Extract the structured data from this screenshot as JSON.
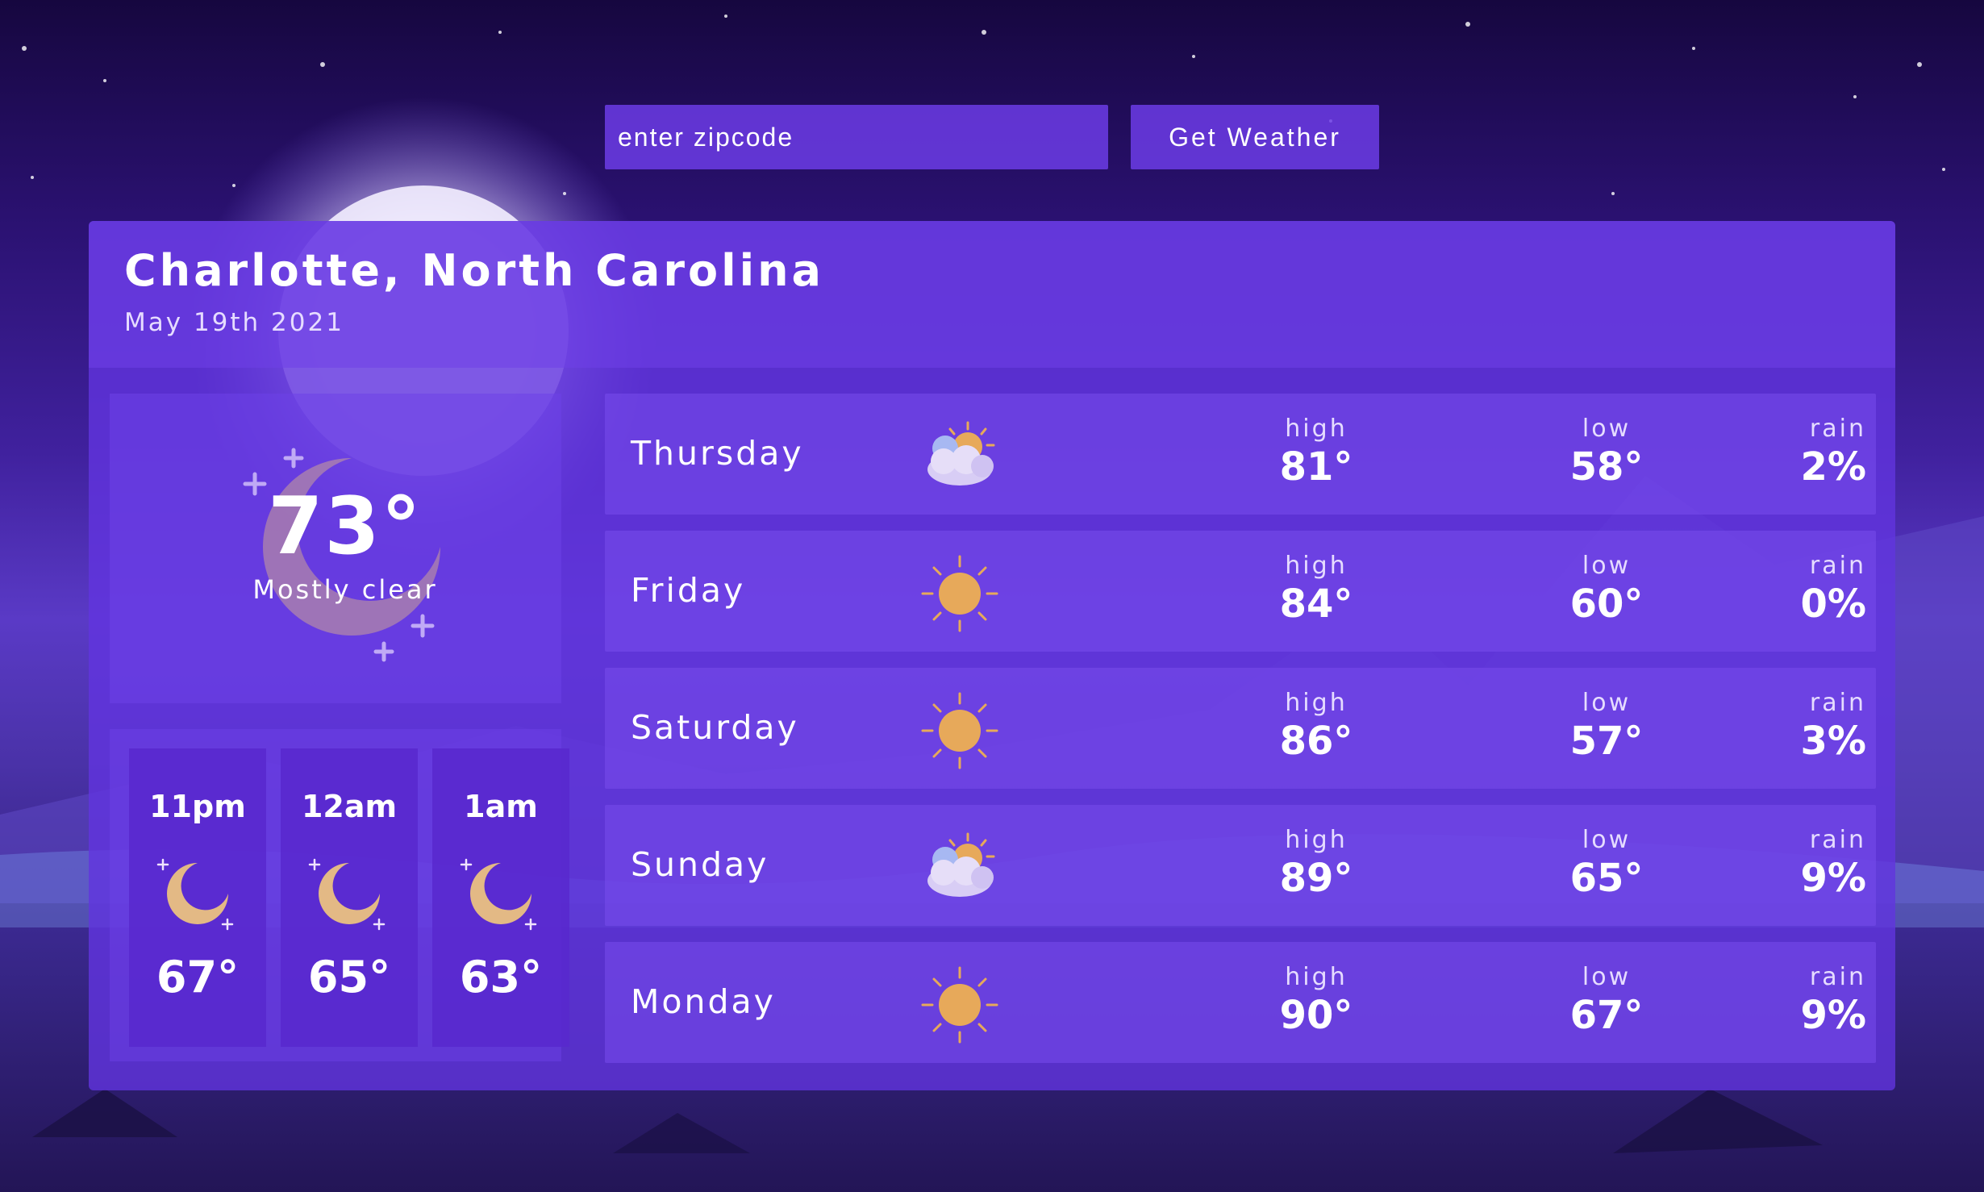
{
  "search": {
    "placeholder": "enter zipcode",
    "button_label": "Get Weather"
  },
  "header": {
    "location": "Charlotte, North Carolina",
    "date": "May 19th 2021"
  },
  "current": {
    "temperature": "73°",
    "condition": "Mostly clear",
    "icon": "crescent-moon-icon"
  },
  "hourly": [
    {
      "time": "11pm",
      "temp": "67°",
      "icon": "moon-icon"
    },
    {
      "time": "12am",
      "temp": "65°",
      "icon": "moon-icon"
    },
    {
      "time": "1am",
      "temp": "63°",
      "icon": "moon-icon"
    }
  ],
  "forecast": {
    "labels": {
      "high": "high",
      "low": "low",
      "rain": "rain"
    },
    "days": [
      {
        "day": "Thursday",
        "icon": "partly-cloudy-icon",
        "high": "81°",
        "low": "58°",
        "rain": "2%"
      },
      {
        "day": "Friday",
        "icon": "sun-icon",
        "high": "84°",
        "low": "60°",
        "rain": "0%"
      },
      {
        "day": "Saturday",
        "icon": "sun-icon",
        "high": "86°",
        "low": "57°",
        "rain": "3%"
      },
      {
        "day": "Sunday",
        "icon": "partly-cloudy-icon",
        "high": "89°",
        "low": "65°",
        "rain": "9%"
      },
      {
        "day": "Monday",
        "icon": "sun-icon",
        "high": "90°",
        "low": "67°",
        "rain": "9%"
      }
    ]
  },
  "colors": {
    "panel": "#6234de",
    "accent": "#6c3ce6",
    "sun": "#e7a95a",
    "moon": "#e3b985",
    "text": "#ffffff"
  }
}
